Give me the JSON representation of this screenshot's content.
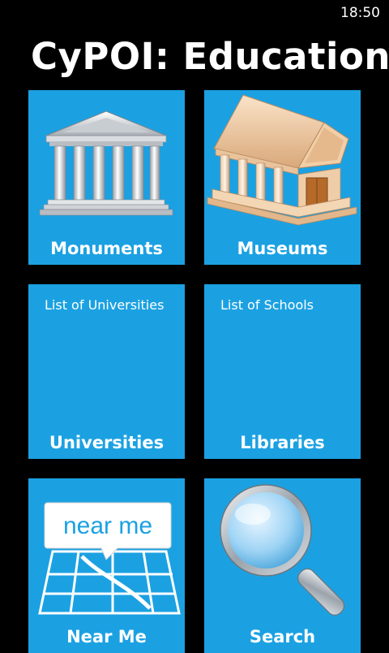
{
  "status_bar": {
    "time": "18:50"
  },
  "app": {
    "title": "CyPOI: Education"
  },
  "tiles": {
    "monuments": {
      "label": "Monuments",
      "icon": "greek-temple-icon"
    },
    "museums": {
      "label": "Museums",
      "icon": "museum-building-icon"
    },
    "universities": {
      "label": "Universities",
      "note": "List of Universities"
    },
    "libraries": {
      "label": "Libraries",
      "note": "List of Schools"
    },
    "near_me": {
      "label": "Near Me",
      "icon": "map-near-me-icon",
      "icon_text": "near me"
    },
    "search": {
      "label": "Search",
      "icon": "magnifying-glass-icon"
    }
  },
  "colors": {
    "background": "#000000",
    "tile": "#1ba1e2",
    "text": "#ffffff"
  }
}
